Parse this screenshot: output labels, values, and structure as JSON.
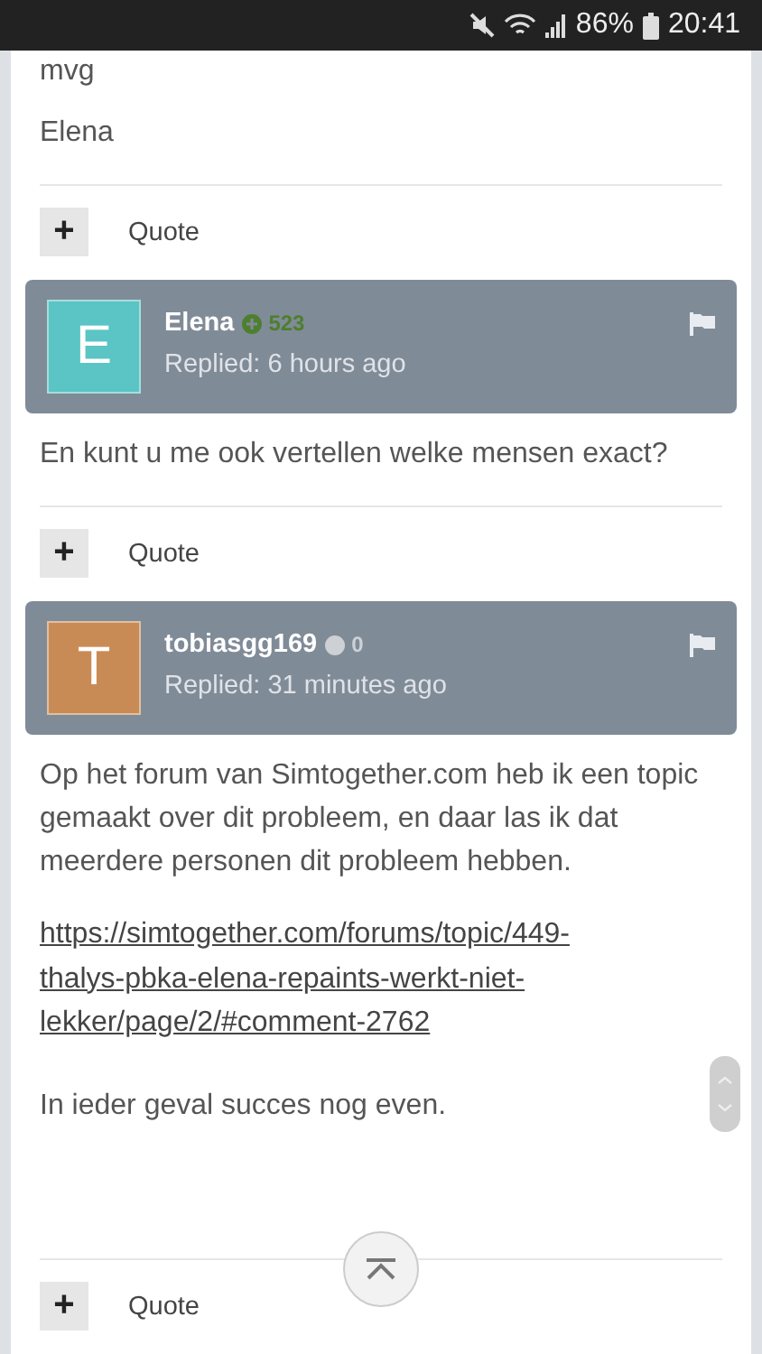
{
  "status_bar": {
    "battery": "86%",
    "time": "20:41"
  },
  "feed": [
    {
      "kind": "text",
      "text": "mvg"
    },
    {
      "kind": "text",
      "text": "Elena"
    },
    {
      "kind": "quote_bar",
      "icon": "+",
      "label": "Quote"
    },
    {
      "kind": "header",
      "avatar_letter": "E",
      "color": "#5bc4c4",
      "author": "Elena",
      "reputation": "523",
      "reputation_positive": true,
      "replied": "Replied: 6 hours ago"
    },
    {
      "kind": "text",
      "text": "En kunt u me ook vertellen welke mensen exact?"
    },
    {
      "kind": "quote_bar",
      "icon": "+",
      "label": "Quote"
    },
    {
      "kind": "header",
      "avatar_letter": "T",
      "color": "#c98b55",
      "author": "tobiasgg169",
      "reputation": "0",
      "reputation_positive": false,
      "replied": "Replied: 31 minutes ago"
    },
    {
      "kind": "text",
      "text": "Op het forum van Simtogether.com heb ik een topic gemaakt over dit probleem, en daar las ik dat meerdere personen dit probleem hebben."
    },
    {
      "kind": "link",
      "text": "https://simtogether.com/forums/topic/449-thalys-pbka-elena-repaints-werkt-niet-lekker/page/2/#comment-2762"
    },
    {
      "kind": "text",
      "text": "In ieder geval succes nog even."
    },
    {
      "kind": "quote_bar",
      "icon": "+",
      "label": "Quote"
    }
  ]
}
